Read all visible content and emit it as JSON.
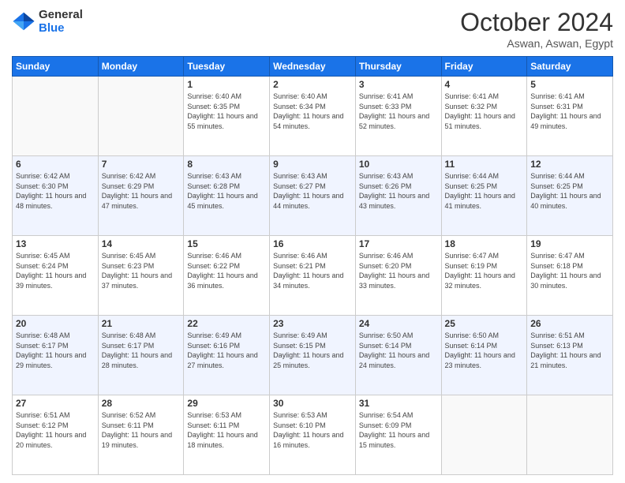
{
  "header": {
    "logo_line1": "General",
    "logo_line2": "Blue",
    "month": "October 2024",
    "location": "Aswan, Aswan, Egypt"
  },
  "weekdays": [
    "Sunday",
    "Monday",
    "Tuesday",
    "Wednesday",
    "Thursday",
    "Friday",
    "Saturday"
  ],
  "weeks": [
    [
      {
        "day": "",
        "info": ""
      },
      {
        "day": "",
        "info": ""
      },
      {
        "day": "1",
        "info": "Sunrise: 6:40 AM\nSunset: 6:35 PM\nDaylight: 11 hours and 55 minutes."
      },
      {
        "day": "2",
        "info": "Sunrise: 6:40 AM\nSunset: 6:34 PM\nDaylight: 11 hours and 54 minutes."
      },
      {
        "day": "3",
        "info": "Sunrise: 6:41 AM\nSunset: 6:33 PM\nDaylight: 11 hours and 52 minutes."
      },
      {
        "day": "4",
        "info": "Sunrise: 6:41 AM\nSunset: 6:32 PM\nDaylight: 11 hours and 51 minutes."
      },
      {
        "day": "5",
        "info": "Sunrise: 6:41 AM\nSunset: 6:31 PM\nDaylight: 11 hours and 49 minutes."
      }
    ],
    [
      {
        "day": "6",
        "info": "Sunrise: 6:42 AM\nSunset: 6:30 PM\nDaylight: 11 hours and 48 minutes."
      },
      {
        "day": "7",
        "info": "Sunrise: 6:42 AM\nSunset: 6:29 PM\nDaylight: 11 hours and 47 minutes."
      },
      {
        "day": "8",
        "info": "Sunrise: 6:43 AM\nSunset: 6:28 PM\nDaylight: 11 hours and 45 minutes."
      },
      {
        "day": "9",
        "info": "Sunrise: 6:43 AM\nSunset: 6:27 PM\nDaylight: 11 hours and 44 minutes."
      },
      {
        "day": "10",
        "info": "Sunrise: 6:43 AM\nSunset: 6:26 PM\nDaylight: 11 hours and 43 minutes."
      },
      {
        "day": "11",
        "info": "Sunrise: 6:44 AM\nSunset: 6:25 PM\nDaylight: 11 hours and 41 minutes."
      },
      {
        "day": "12",
        "info": "Sunrise: 6:44 AM\nSunset: 6:25 PM\nDaylight: 11 hours and 40 minutes."
      }
    ],
    [
      {
        "day": "13",
        "info": "Sunrise: 6:45 AM\nSunset: 6:24 PM\nDaylight: 11 hours and 39 minutes."
      },
      {
        "day": "14",
        "info": "Sunrise: 6:45 AM\nSunset: 6:23 PM\nDaylight: 11 hours and 37 minutes."
      },
      {
        "day": "15",
        "info": "Sunrise: 6:46 AM\nSunset: 6:22 PM\nDaylight: 11 hours and 36 minutes."
      },
      {
        "day": "16",
        "info": "Sunrise: 6:46 AM\nSunset: 6:21 PM\nDaylight: 11 hours and 34 minutes."
      },
      {
        "day": "17",
        "info": "Sunrise: 6:46 AM\nSunset: 6:20 PM\nDaylight: 11 hours and 33 minutes."
      },
      {
        "day": "18",
        "info": "Sunrise: 6:47 AM\nSunset: 6:19 PM\nDaylight: 11 hours and 32 minutes."
      },
      {
        "day": "19",
        "info": "Sunrise: 6:47 AM\nSunset: 6:18 PM\nDaylight: 11 hours and 30 minutes."
      }
    ],
    [
      {
        "day": "20",
        "info": "Sunrise: 6:48 AM\nSunset: 6:17 PM\nDaylight: 11 hours and 29 minutes."
      },
      {
        "day": "21",
        "info": "Sunrise: 6:48 AM\nSunset: 6:17 PM\nDaylight: 11 hours and 28 minutes."
      },
      {
        "day": "22",
        "info": "Sunrise: 6:49 AM\nSunset: 6:16 PM\nDaylight: 11 hours and 27 minutes."
      },
      {
        "day": "23",
        "info": "Sunrise: 6:49 AM\nSunset: 6:15 PM\nDaylight: 11 hours and 25 minutes."
      },
      {
        "day": "24",
        "info": "Sunrise: 6:50 AM\nSunset: 6:14 PM\nDaylight: 11 hours and 24 minutes."
      },
      {
        "day": "25",
        "info": "Sunrise: 6:50 AM\nSunset: 6:14 PM\nDaylight: 11 hours and 23 minutes."
      },
      {
        "day": "26",
        "info": "Sunrise: 6:51 AM\nSunset: 6:13 PM\nDaylight: 11 hours and 21 minutes."
      }
    ],
    [
      {
        "day": "27",
        "info": "Sunrise: 6:51 AM\nSunset: 6:12 PM\nDaylight: 11 hours and 20 minutes."
      },
      {
        "day": "28",
        "info": "Sunrise: 6:52 AM\nSunset: 6:11 PM\nDaylight: 11 hours and 19 minutes."
      },
      {
        "day": "29",
        "info": "Sunrise: 6:53 AM\nSunset: 6:11 PM\nDaylight: 11 hours and 18 minutes."
      },
      {
        "day": "30",
        "info": "Sunrise: 6:53 AM\nSunset: 6:10 PM\nDaylight: 11 hours and 16 minutes."
      },
      {
        "day": "31",
        "info": "Sunrise: 6:54 AM\nSunset: 6:09 PM\nDaylight: 11 hours and 15 minutes."
      },
      {
        "day": "",
        "info": ""
      },
      {
        "day": "",
        "info": ""
      }
    ]
  ]
}
